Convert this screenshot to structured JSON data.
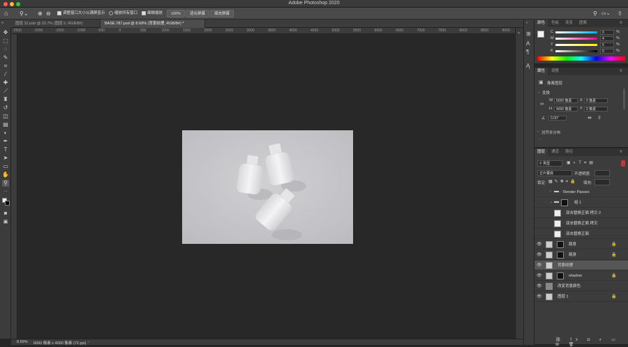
{
  "window": {
    "title": "Adobe Photoshop 2020"
  },
  "options": {
    "resize_windows": "调整窗口大小以满屏显示",
    "zoom_all": "缩放所有窗口",
    "scrubby_zoom": "细微缩放",
    "zoom_value": "100%",
    "fit_screen": "适合屏幕",
    "fill_screen": "填充屏幕"
  },
  "tabs": [
    {
      "label": "图层 32.psb @ 33.7% (图层 5, RGB/8#)"
    },
    {
      "label": "BASE.787.psd @ 8.69% (背景纹理, RGB/8#) *"
    }
  ],
  "ruler_ticks": [
    "-2500",
    "-2000",
    "-1500",
    "-1000",
    "-500",
    "0",
    "500",
    "1000",
    "1500",
    "2000",
    "2500",
    "3000",
    "3500",
    "4000",
    "4500",
    "5000",
    "5500",
    "6000",
    "6500",
    "7000",
    "7500",
    "8000",
    "8500",
    "9000"
  ],
  "status": {
    "zoom": "8.69%",
    "doc_info": "6000 像素 x 4000 像素 (72 ppi)"
  },
  "color_panel": {
    "tabs": [
      "颜色",
      "色板",
      "渐变",
      "图案"
    ],
    "channels": [
      {
        "label": "C",
        "value": "0",
        "unit": "%"
      },
      {
        "label": "M",
        "value": "4",
        "unit": "%"
      },
      {
        "label": "Y",
        "value": "6",
        "unit": "%"
      },
      {
        "label": "K",
        "value": "0",
        "unit": "%"
      }
    ]
  },
  "properties_panel": {
    "tabs": [
      "属性",
      "调整"
    ],
    "layer_type": "像素图层",
    "transform_title": "变换",
    "w": "6000 像素",
    "h": "4000 像素",
    "x": "0 像素",
    "y": "0 像素",
    "angle": "0.00°",
    "align_title": "对齐并分布",
    "more": "..."
  },
  "layers_panel": {
    "tabs": [
      "图层",
      "通道",
      "路径"
    ],
    "filter": "类型",
    "blend_mode": "正片叠底",
    "opacity_label": "不透明度:",
    "lock_label": "锁定:",
    "fill_label": "填充:",
    "layers": [
      {
        "name": "Render Passes",
        "kind": "group",
        "visible": false,
        "indent": 1
      },
      {
        "name": "组 1",
        "kind": "group-mask",
        "visible": false,
        "indent": 1
      },
      {
        "name": "双击替换正面 拷贝 2",
        "kind": "smart",
        "visible": false,
        "indent": 2
      },
      {
        "name": "双击替换正面 拷贝",
        "kind": "smart",
        "visible": false,
        "indent": 2
      },
      {
        "name": "双击替换正面",
        "kind": "smart",
        "visible": false,
        "indent": 2
      },
      {
        "name": "瓶身",
        "kind": "masked",
        "visible": true,
        "indent": 0,
        "locked": true
      },
      {
        "name": "瓶身",
        "kind": "masked",
        "visible": true,
        "indent": 0,
        "locked": true
      },
      {
        "name": "背景纹理",
        "kind": "selected",
        "visible": true,
        "indent": 0
      },
      {
        "name": "shadow",
        "kind": "masked",
        "visible": true,
        "indent": 0,
        "locked": true
      },
      {
        "name": "改变背景颜色",
        "kind": "adjust",
        "visible": true,
        "indent": 0
      },
      {
        "name": "图层 1",
        "kind": "plain",
        "visible": true,
        "indent": 0,
        "locked": true
      }
    ]
  },
  "colors": {
    "accent": "#2d7bd6",
    "selected_row": "#565656"
  }
}
